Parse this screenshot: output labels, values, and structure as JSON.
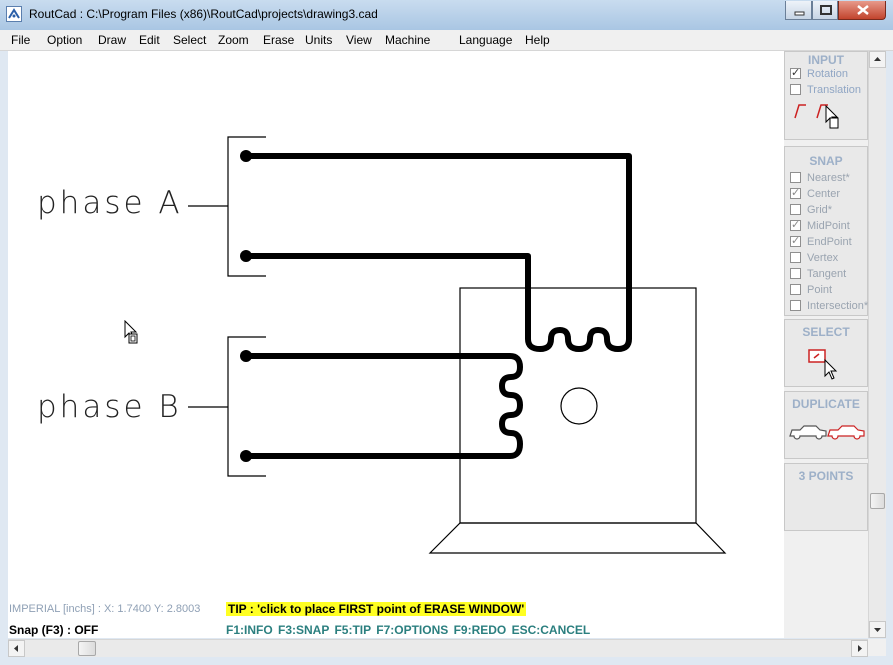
{
  "window": {
    "title": "RoutCad : C:\\Program Files (x86)\\RoutCad\\projects\\drawing3.cad"
  },
  "menu": [
    "File",
    "Option",
    "Draw",
    "Edit",
    "Select",
    "Zoom",
    "Erase",
    "Units",
    "View",
    "Machine",
    "Language",
    "Help"
  ],
  "drawing": {
    "label_a": "phase  A",
    "label_b": "phase  B"
  },
  "status": {
    "coords": "IMPERIAL [inchs] : X: 1.7400  Y: 2.8003",
    "tip": "TIP : 'click to place FIRST point of  ERASE WINDOW'",
    "snap": "Snap (F3) : OFF",
    "fkeys": "F1:INFO  F3:SNAP  F5:TIP  F7:OPTIONS  F9:REDO  ESC:CANCEL"
  },
  "panel": {
    "input": {
      "title": "INPUT",
      "rotation": "Rotation",
      "translation": "Translation",
      "rotation_checked": true,
      "translation_checked": false
    },
    "snap": {
      "title": "SNAP",
      "items": [
        {
          "label": "Nearest*",
          "checked": false
        },
        {
          "label": "Center",
          "checked": true
        },
        {
          "label": "Grid*",
          "checked": false
        },
        {
          "label": "MidPoint",
          "checked": true
        },
        {
          "label": "EndPoint",
          "checked": true
        },
        {
          "label": "Vertex",
          "checked": false
        },
        {
          "label": "Tangent",
          "checked": false
        },
        {
          "label": "Point",
          "checked": false
        },
        {
          "label": "Intersection*",
          "checked": false
        }
      ]
    },
    "select": {
      "title": "SELECT"
    },
    "duplicate": {
      "title": "DUPLICATE"
    },
    "three_points": {
      "title": "3 POINTS"
    }
  },
  "colors": {
    "accent_red": "#cc2222",
    "tip_bg": "#ffff22",
    "fkey_text": "#2b7f7f",
    "panel_title": "#9db0c8"
  }
}
